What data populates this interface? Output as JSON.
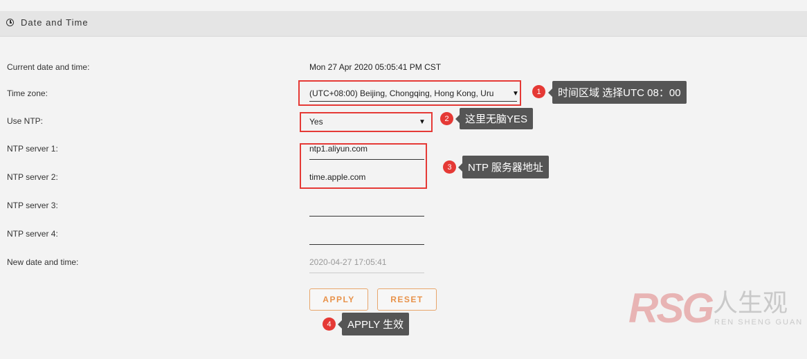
{
  "section": {
    "title": "Date and Time",
    "icon": "clock-icon"
  },
  "fields": {
    "current_label": "Current date and time:",
    "current_value": "Mon 27 Apr 2020 05:05:41 PM CST",
    "timezone_label": "Time zone:",
    "timezone_value": "(UTC+08:00) Beijing, Chongqing, Hong Kong, Uru",
    "ntp_label": "Use NTP:",
    "ntp_value": "Yes",
    "ntp1_label": "NTP server 1:",
    "ntp1_value": "ntp1.aliyun.com",
    "ntp2_label": "NTP server 2:",
    "ntp2_value": "time.apple.com",
    "ntp3_label": "NTP server 3:",
    "ntp3_value": "",
    "ntp4_label": "NTP server 4:",
    "ntp4_value": "",
    "newdate_label": "New date and time:",
    "newdate_placeholder": "2020-04-27 17:05:41"
  },
  "buttons": {
    "apply": "APPLY",
    "reset": "RESET"
  },
  "annotations": [
    {
      "num": "1",
      "text": "时间区域 选择UTC 08：00"
    },
    {
      "num": "2",
      "text": "这里无脑YES"
    },
    {
      "num": "3",
      "text": "NTP 服务器地址"
    },
    {
      "num": "4",
      "text": "APPLY 生效"
    }
  ],
  "watermark": {
    "logo": "RSG",
    "cn": "人生观",
    "en": "REN SHENG GUAN"
  },
  "colors": {
    "accent": "#e8924a",
    "highlight": "#e53935",
    "callout_bg": "#555555"
  }
}
